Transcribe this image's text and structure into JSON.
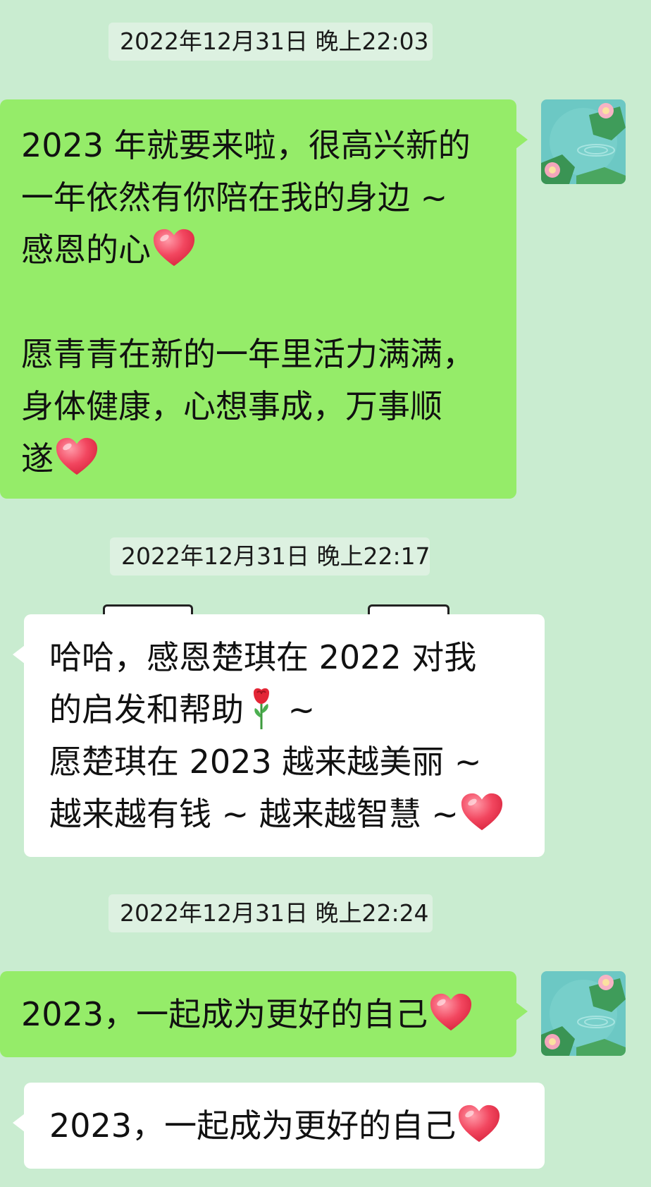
{
  "chat": {
    "timestamps": [
      "2022年12月31日 晚上22:03",
      "2022年12月31日 晚上22:17",
      "2022年12月31日 晚上22:24"
    ],
    "msg1": {
      "line1": "2023 年就要来啦，很高兴新的",
      "line2": "一年依然有你陪在我的身边 ~",
      "line3": "感恩的心",
      "line4": "愿青青在新的一年里活力满满，",
      "line5": "身体健康，心想事成，万事顺",
      "line6": "遂",
      "emoji": "heart-emoji"
    },
    "msg2": {
      "line1": "哈哈，感恩楚琪在 2022 对我",
      "line2": "的启发和帮助",
      "line2_after": " ~",
      "line3": "愿楚琪在 2023 越来越美丽 ~",
      "line4": "越来越有钱 ~ 越来越智慧 ~",
      "emoji_rose": "rose-emoji",
      "emoji_heart": "heart-emoji"
    },
    "msg3": {
      "text": "2023，一起成为更好的自己"
    },
    "msg4": {
      "text": "2023，一起成为更好的自己"
    }
  },
  "colors": {
    "background": "#c9ecd0",
    "sent_bubble": "#95ec69",
    "received_bubble": "#ffffff",
    "timestamp_bg": "#ddf1e1",
    "heart": "#f2465f"
  }
}
